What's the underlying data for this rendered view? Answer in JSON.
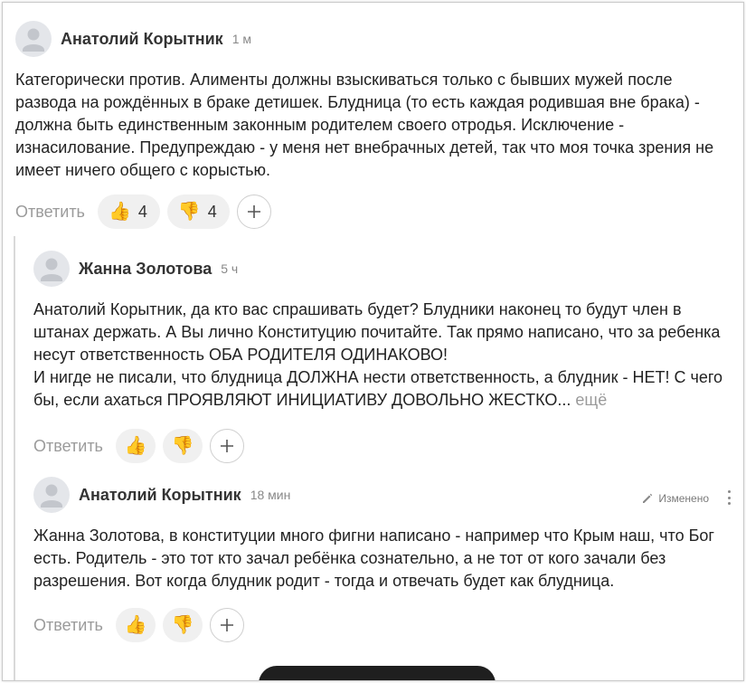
{
  "comments": [
    {
      "author": "Анатолий Корытник",
      "time": "1 м",
      "text": "Категорически против. Алименты должны взыскиваться только с бывших мужей после развода на рождённых в браке детишек. Блудница (то есть каждая родившая вне брака) - должна быть единственным законным родителем своего отродья. Исключение - изнасилование. Предупреждаю - у меня нет внебрачных детей, так что моя точка зрения не имеет ничего общего с корыстью.",
      "reply_label": "Ответить",
      "likes": "4",
      "dislikes": "4"
    },
    {
      "author": "Жанна Золотова",
      "time": "5 ч",
      "text_lines": [
        "Анатолий Корытник, да кто вас спрашивать будет? Блудники наконец то будут член в штанах держать. А Вы лично Конституцию почитайте. Так прямо написано, что за ребенка несут ответственность ОБА РОДИТЕЛЯ ОДИНАКОВО!",
        "И нигде не писали, что блудница ДОЛЖНА нести ответственность, а блудник - НЕТ! С чего бы, если ахаться ПРОЯВЛЯЮТ ИНИЦИАТИВУ ДОВОЛЬНО ЖЕСТКО..."
      ],
      "more_label": "ещё",
      "reply_label": "Ответить"
    },
    {
      "author": "Анатолий Корытник",
      "time": "18 мин",
      "edited_label": "Изменено",
      "text": "Жанна Золотова, в конституции много фигни написано - например что Крым наш, что Бог есть. Родитель - это тот кто зачал ребёнка сознательно, а не тот от кого зачали без разрешения. Вот когда блудник родит - тогда и отвечать будет как блудница.",
      "reply_label": "Ответить"
    }
  ],
  "icons": {
    "like": "thumbs-up-icon",
    "dislike": "thumbs-down-icon",
    "add_reaction": "plus-icon",
    "avatar": "user-avatar-icon",
    "edit": "pencil-icon",
    "more": "kebab-menu-icon"
  },
  "colors": {
    "reaction_bg": "#f0f0f0",
    "muted_text": "#9b9b9b",
    "thread_line": "#d9d9d9"
  }
}
